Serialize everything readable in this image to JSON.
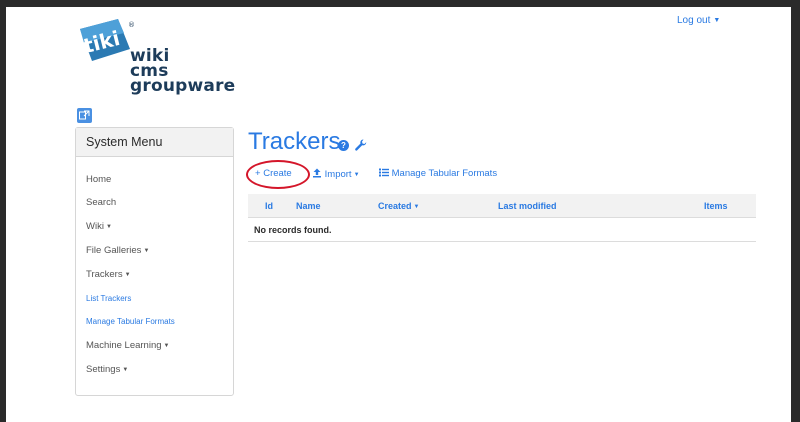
{
  "logo": {
    "line1": "wiki",
    "line2": "cms",
    "line3": "groupware",
    "badge": "tiki"
  },
  "header": {
    "logout_label": "Log out"
  },
  "sidebar": {
    "title": "System Menu",
    "items": [
      {
        "label": "Home",
        "caret": false,
        "sub": false
      },
      {
        "label": "Search",
        "caret": false,
        "sub": false
      },
      {
        "label": "Wiki",
        "caret": true,
        "sub": false
      },
      {
        "label": "File Galleries",
        "caret": true,
        "sub": false
      },
      {
        "label": "Trackers",
        "caret": true,
        "sub": false
      },
      {
        "label": "List Trackers",
        "caret": false,
        "sub": true
      },
      {
        "label": "Manage Tabular Formats",
        "caret": false,
        "sub": true
      },
      {
        "label": "Machine Learning",
        "caret": true,
        "sub": false
      },
      {
        "label": "Settings",
        "caret": true,
        "sub": false
      }
    ]
  },
  "main": {
    "title": "Trackers",
    "actions": {
      "create": "Create",
      "import": "Import",
      "tabular": "Manage Tabular Formats"
    },
    "table": {
      "columns": [
        "Id",
        "Name",
        "Created",
        "Last modified",
        "Items"
      ],
      "empty_message": "No records found."
    }
  },
  "colors": {
    "accent": "#2a7ae2",
    "highlight_oval": "#d4162a"
  }
}
